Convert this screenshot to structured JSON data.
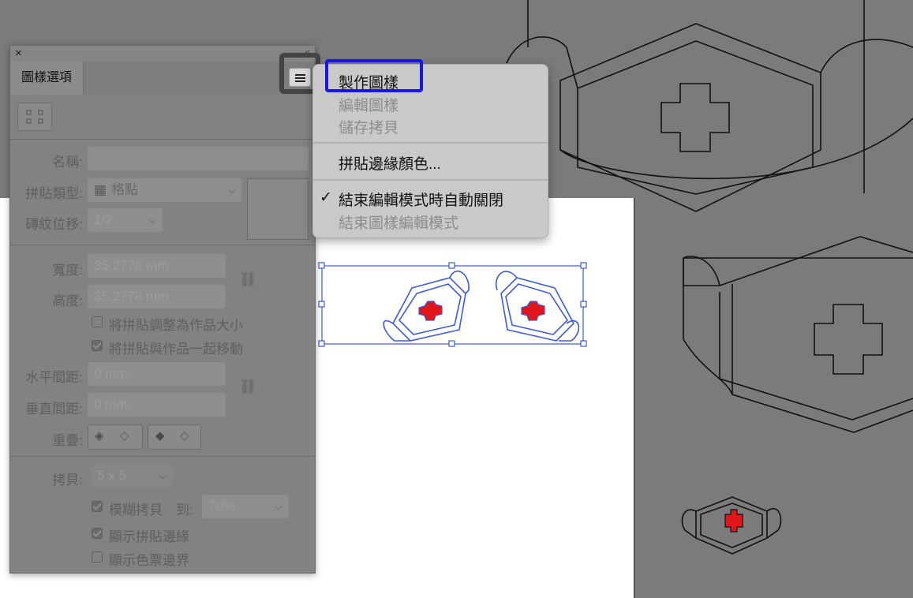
{
  "panel": {
    "close_icon": "×",
    "collapse_icon": "«",
    "tab_label": "圖樣選項",
    "name_label": "名稱:",
    "tile_type_label": "拼貼類型:",
    "tile_type_value": "格點",
    "brick_offset_label": "磚紋位移:",
    "brick_offset_value": "1/2",
    "width_label": "寬度:",
    "width_value": "35.2778 mm",
    "height_label": "高度:",
    "height_value": "35.2778 mm",
    "resize_tile_label": "將拼貼調整為作品大小",
    "resize_tile_checked": false,
    "move_tile_label": "將拼貼與作品一起移動",
    "move_tile_checked": true,
    "h_spacing_label": "水平間距:",
    "h_spacing_value": "0 mm",
    "v_spacing_label": "垂直間距:",
    "v_spacing_value": "0 mm",
    "overlap_label": "重疊:",
    "copies_label": "拷貝:",
    "copies_value": "5 x 5",
    "dim_copies_label": "模糊拷貝",
    "dim_copies_to": "到:",
    "dim_copies_value": "70%",
    "dim_copies_checked": true,
    "show_tile_edge_label": "顯示拼貼邊緣",
    "show_tile_edge_checked": true,
    "show_swatch_bounds_label": "顯示色票邊界",
    "show_swatch_bounds_checked": false
  },
  "menu": {
    "items": [
      {
        "label": "製作圖樣",
        "enabled": true,
        "highlighted": true
      },
      {
        "label": "編輯圖樣",
        "enabled": false
      },
      {
        "label": "儲存拷貝",
        "enabled": false
      },
      {
        "label": "拼貼邊緣顏色...",
        "enabled": true
      },
      {
        "label": "結束編輯模式時自動關閉",
        "enabled": true,
        "checked": true
      },
      {
        "label": "結束圖樣編輯模式",
        "enabled": false
      }
    ],
    "check_glyph": "✓"
  },
  "colors": {
    "highlight": "#1a16e8",
    "selection": "#3a5bd9",
    "red_cross": "#e0161b"
  }
}
